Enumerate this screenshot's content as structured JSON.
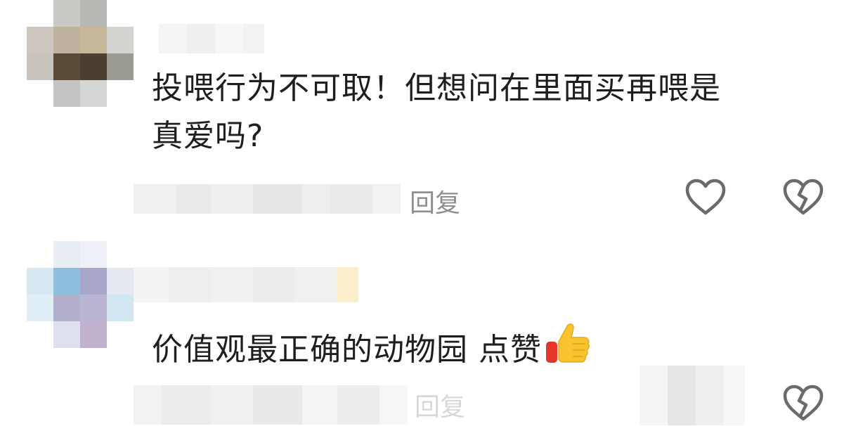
{
  "comments": [
    {
      "text_line1": "投喂行为不可取！但想问在里面买再喂是",
      "text_line2": "真爱吗?",
      "reply_label": "回复",
      "like_icon": "heart-outline-icon",
      "dislike_icon": "broken-heart-icon"
    },
    {
      "text": "价值观最正确的动物园 点赞",
      "emoji": "thumbs-up-icon",
      "reply_label": "回复",
      "dislike_icon": "broken-heart-icon"
    }
  ],
  "colors": {
    "text": "#1e1e1e",
    "reply": "#8f8f8f",
    "icon": "#6b6b6b",
    "thumb_yellow": "#f7c32e",
    "thumb_red": "#e2362b"
  }
}
